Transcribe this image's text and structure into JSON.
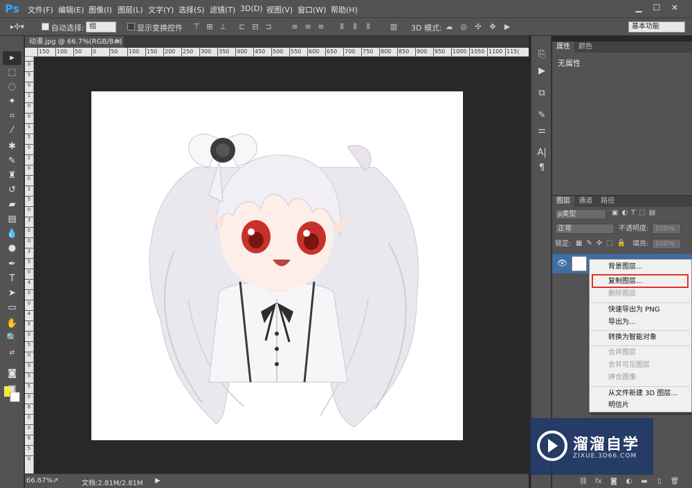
{
  "app": {
    "logo": "Ps"
  },
  "menu": [
    "文件(F)",
    "编辑(E)",
    "图像(I)",
    "图层(L)",
    "文字(Y)",
    "选择(S)",
    "滤镜(T)",
    "3D(D)",
    "视图(V)",
    "窗口(W)",
    "帮助(H)"
  ],
  "window_controls": {
    "minimize": "▁",
    "maximize": "☐",
    "close": "✕"
  },
  "options_bar": {
    "auto_select_label": "自动选择:",
    "auto_select_value": "组",
    "show_transform_label": "显示变换控件",
    "mode_3d_label": "3D 模式:",
    "workspace": "基本功能"
  },
  "document": {
    "tab_title": "动漫.jpg @ 66.7%(RGB/8#)",
    "tab_close": "×",
    "ruler_top": [
      "150",
      "100",
      "50",
      "0",
      "50",
      "100",
      "150",
      "200",
      "250",
      "300",
      "350",
      "400",
      "450",
      "500",
      "550",
      "600",
      "650",
      "700",
      "750",
      "800",
      "850",
      "900",
      "950",
      "1000",
      "1050",
      "1100",
      "115("
    ],
    "ruler_left": [
      "0",
      "5",
      "0",
      "1",
      "0",
      "0",
      "1",
      "5",
      "0",
      "2",
      "0",
      "0",
      "2",
      "5",
      "0",
      "3",
      "0",
      "0",
      "3",
      "5",
      "0",
      "4",
      "0",
      "0",
      "4",
      "5",
      "0",
      "5",
      "0",
      "0",
      "5",
      "5",
      "0",
      "6",
      "0",
      "0",
      "6",
      "5",
      "0"
    ]
  },
  "status": {
    "zoom": "66.67%",
    "doc_size": "文档:2.81M/2.81M"
  },
  "properties_panel": {
    "tabs": [
      "属性",
      "颜色"
    ],
    "content": "无属性"
  },
  "layers_panel": {
    "tabs": [
      "图层",
      "通道",
      "路径"
    ],
    "filter_label": "ρ类型",
    "blend_mode": "正常",
    "opacity_label": "不透明度:",
    "opacity_value": "100%",
    "lock_label": "锁定:",
    "fill_label": "填充:",
    "fill_value": "100%"
  },
  "context_menu": {
    "items": [
      {
        "label": "背景图层...",
        "enabled": true
      },
      {
        "label": "复制图层...",
        "enabled": true,
        "highlighted": true
      },
      {
        "label": "删除图层",
        "enabled": false
      },
      {
        "label": "快速导出为 PNG",
        "enabled": true
      },
      {
        "label": "导出为...",
        "enabled": true
      },
      {
        "label": "转换为智能对象",
        "enabled": true
      },
      {
        "label": "合并图层",
        "enabled": false
      },
      {
        "label": "合并可见图层",
        "enabled": false
      },
      {
        "label": "拼合图像",
        "enabled": false
      },
      {
        "label": "从文件新建 3D 图层...",
        "enabled": true
      },
      {
        "label": "明信片",
        "enabled": true
      }
    ]
  },
  "watermark": {
    "title": "溜溜自学",
    "subtitle": "ZIXUE.3D66.COM"
  },
  "colors": {
    "foreground": "#fff200",
    "background": "#ffffff",
    "highlight_box": "#e0312a",
    "layer_selected": "#3d6fa3"
  }
}
